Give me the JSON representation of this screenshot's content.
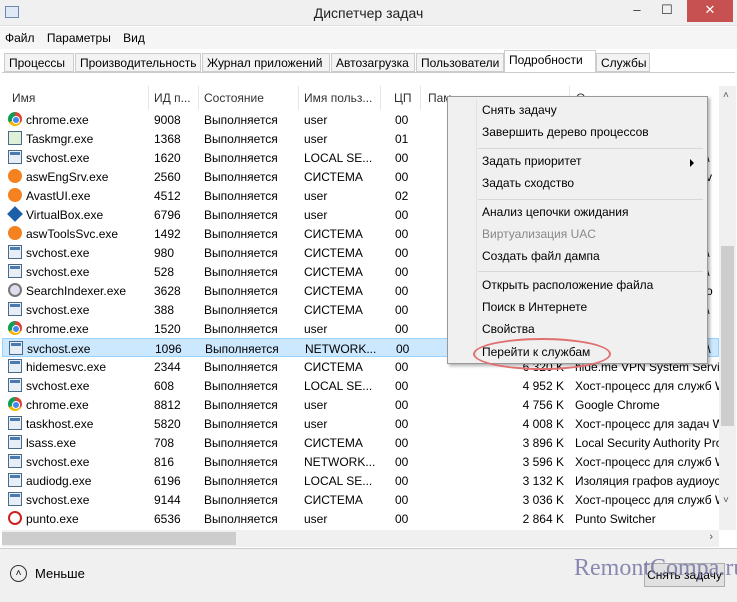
{
  "window": {
    "title": "Диспетчер задач",
    "minimize": "–",
    "maximize": "☐",
    "close": "✕"
  },
  "menu": [
    "Файл",
    "Параметры",
    "Вид"
  ],
  "tabs": [
    {
      "label": "Процессы"
    },
    {
      "label": "Производительность"
    },
    {
      "label": "Журнал приложений"
    },
    {
      "label": "Автозагрузка"
    },
    {
      "label": "Пользователи"
    },
    {
      "label": "Подробности",
      "active": true
    },
    {
      "label": "Службы"
    }
  ],
  "columns": {
    "name": "Имя",
    "pid": "ИД п...",
    "status": "Состояние",
    "user": "Имя польз...",
    "cpu": "ЦП",
    "mem": "Пам",
    "desc": "О"
  },
  "rows": [
    {
      "icon": "chrome",
      "name": "chrome.exe",
      "pid": "9008",
      "status": "Выполняется",
      "user": "user",
      "cpu": "00",
      "mem": "",
      "desc": ""
    },
    {
      "icon": "task",
      "name": "Taskmgr.exe",
      "pid": "1368",
      "status": "Выполняется",
      "user": "user",
      "cpu": "01",
      "mem": "",
      "desc": ""
    },
    {
      "icon": "svc",
      "name": "svchost.exe",
      "pid": "1620",
      "status": "Выполняется",
      "user": "LOCAL SE...",
      "cpu": "00",
      "mem": "",
      "desc": "б \\"
    },
    {
      "icon": "avast",
      "name": "aswEngSrv.exe",
      "pid": "2560",
      "status": "Выполняется",
      "user": "СИСТЕМА",
      "cpu": "00",
      "mem": "",
      "desc": "rv"
    },
    {
      "icon": "avast",
      "name": "AvastUI.exe",
      "pid": "4512",
      "status": "Выполняется",
      "user": "user",
      "cpu": "02",
      "mem": "",
      "desc": ""
    },
    {
      "icon": "vbox",
      "name": "VirtualBox.exe",
      "pid": "6796",
      "status": "Выполняется",
      "user": "user",
      "cpu": "00",
      "mem": "",
      "desc": ""
    },
    {
      "icon": "avast",
      "name": "aswToolsSvc.exe",
      "pid": "1492",
      "status": "Выполняется",
      "user": "СИСТЕМА",
      "cpu": "00",
      "mem": "",
      "desc": ""
    },
    {
      "icon": "svc",
      "name": "svchost.exe",
      "pid": "980",
      "status": "Выполняется",
      "user": "СИСТЕМА",
      "cpu": "00",
      "mem": "",
      "desc": "б \\"
    },
    {
      "icon": "svc",
      "name": "svchost.exe",
      "pid": "528",
      "status": "Выполняется",
      "user": "СИСТЕМА",
      "cpu": "00",
      "mem": "",
      "desc": "б \\"
    },
    {
      "icon": "search",
      "name": "SearchIndexer.exe",
      "pid": "3628",
      "status": "Выполняется",
      "user": "СИСТЕМА",
      "cpu": "00",
      "mem": "",
      "desc": "cro"
    },
    {
      "icon": "svc",
      "name": "svchost.exe",
      "pid": "388",
      "status": "Выполняется",
      "user": "СИСТЕМА",
      "cpu": "00",
      "mem": "",
      "desc": "б \\"
    },
    {
      "icon": "chrome",
      "name": "chrome.exe",
      "pid": "1520",
      "status": "Выполняется",
      "user": "user",
      "cpu": "00",
      "mem": "",
      "desc": ""
    },
    {
      "icon": "svc",
      "name": "svchost.exe",
      "pid": "1096",
      "status": "Выполняется",
      "user": "NETWORK...",
      "cpu": "00",
      "mem": "",
      "desc": "б \\",
      "selected": true
    },
    {
      "icon": "svc",
      "name": "hidemesvc.exe",
      "pid": "2344",
      "status": "Выполняется",
      "user": "СИСТЕМА",
      "cpu": "00",
      "mem": "6 320 K",
      "desc": "hide.me VPN System Service"
    },
    {
      "icon": "svc",
      "name": "svchost.exe",
      "pid": "608",
      "status": "Выполняется",
      "user": "LOCAL SE...",
      "cpu": "00",
      "mem": "4 952 K",
      "desc": "Хост-процесс для служб W"
    },
    {
      "icon": "chrome",
      "name": "chrome.exe",
      "pid": "8812",
      "status": "Выполняется",
      "user": "user",
      "cpu": "00",
      "mem": "4 756 K",
      "desc": "Google Chrome"
    },
    {
      "icon": "svc",
      "name": "taskhost.exe",
      "pid": "5820",
      "status": "Выполняется",
      "user": "user",
      "cpu": "00",
      "mem": "4 008 K",
      "desc": "Хост-процесс для задач W"
    },
    {
      "icon": "svc",
      "name": "lsass.exe",
      "pid": "708",
      "status": "Выполняется",
      "user": "СИСТЕМА",
      "cpu": "00",
      "mem": "3 896 K",
      "desc": "Local Security Authority Pro"
    },
    {
      "icon": "svc",
      "name": "svchost.exe",
      "pid": "816",
      "status": "Выполняется",
      "user": "NETWORK...",
      "cpu": "00",
      "mem": "3 596 K",
      "desc": "Хост-процесс для служб W"
    },
    {
      "icon": "svc",
      "name": "audiodg.exe",
      "pid": "6196",
      "status": "Выполняется",
      "user": "LOCAL SE...",
      "cpu": "00",
      "mem": "3 132 K",
      "desc": "Изоляция графов аудиоус"
    },
    {
      "icon": "svc",
      "name": "svchost.exe",
      "pid": "9144",
      "status": "Выполняется",
      "user": "СИСТЕМА",
      "cpu": "00",
      "mem": "3 036 K",
      "desc": "Хост-процесс для служб W"
    },
    {
      "icon": "punto",
      "name": "punto.exe",
      "pid": "6536",
      "status": "Выполняется",
      "user": "user",
      "cpu": "00",
      "mem": "2 864 K",
      "desc": "Punto Switcher"
    }
  ],
  "context_menu": [
    {
      "label": "Снять задачу"
    },
    {
      "label": "Завершить дерево процессов"
    },
    {
      "label": "Задать приоритет",
      "submenu": true
    },
    {
      "label": "Задать сходство"
    },
    {
      "label": "Анализ цепочки ожидания"
    },
    {
      "label": "Виртуализация UAC",
      "disabled": true
    },
    {
      "label": "Создать файл дампа"
    },
    {
      "label": "Открыть расположение файла"
    },
    {
      "label": "Поиск в Интернете"
    },
    {
      "label": "Свойства"
    },
    {
      "label": "Перейти к службам",
      "highlighted": true
    }
  ],
  "footer": {
    "less": "Меньше",
    "end_task": "Снять задачу",
    "watermark": "RemontCompa.ru"
  },
  "colors": {
    "selection": "#cce8ff",
    "close": "#c75050",
    "highlight_ring": "#e07070"
  }
}
